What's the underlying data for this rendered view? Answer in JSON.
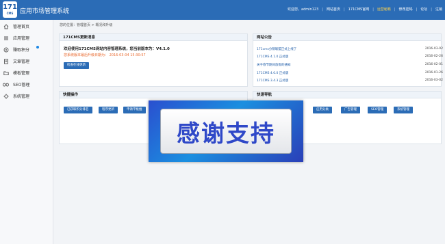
{
  "header": {
    "logo_number": "171",
    "logo_caption": "CMS",
    "title": "应用市场管理系统",
    "nav": [
      "欢迎您，admin123",
      "网站首页",
      "171CMS官网",
      "运营秘籍",
      "修改密码",
      "论坛",
      "注销"
    ]
  },
  "sidebar": {
    "items": [
      {
        "label": "管理首页",
        "icon": "home-icon"
      },
      {
        "label": "应用管理",
        "icon": "list-icon"
      },
      {
        "label": "赚取积分",
        "icon": "coin-icon"
      },
      {
        "label": "文章管理",
        "icon": "document-icon"
      },
      {
        "label": "模板管理",
        "icon": "folder-icon"
      },
      {
        "label": "SEO管理",
        "icon": "seo-icon"
      },
      {
        "label": "系统管理",
        "icon": "gear-icon"
      }
    ]
  },
  "breadcrumb": "您的位置：管理首页 > 概况和升级",
  "update_panel": {
    "title": "171CMS更新消息",
    "welcome": "欢迎使用171CMS网站内容管理系统，您当前版本为：V4.1.0",
    "notice": "您系统版本最后升级日期为： 2016-03-04 15:30:57",
    "button": "检查在线更新"
  },
  "announce_panel": {
    "title": "网站公告",
    "items": [
      {
        "text": "171cms分销联盟正式上线了",
        "date": "2016-03-02"
      },
      {
        "text": "171CMS 4.1.0 正式版",
        "date": "2016-02-26"
      },
      {
        "text": "关于春节期间放假的通知",
        "date": "2016-02-01"
      },
      {
        "text": "171CMS 4.0.0 正式版",
        "date": "2016-01-26"
      },
      {
        "text": "171CMS 3.4.3 正式版",
        "date": "2016-03-02"
      }
    ]
  },
  "quick_ops": {
    "title": "快捷操作",
    "buttons": [
      "已获取积分排名",
      "程序更新",
      "申请平板推"
    ]
  },
  "quick_nav": {
    "title": "快速导航",
    "buttons": [
      "应用分类",
      "广告管理",
      "SEO管理",
      "系统管理"
    ]
  },
  "overlay": {
    "text": "感谢支持"
  }
}
